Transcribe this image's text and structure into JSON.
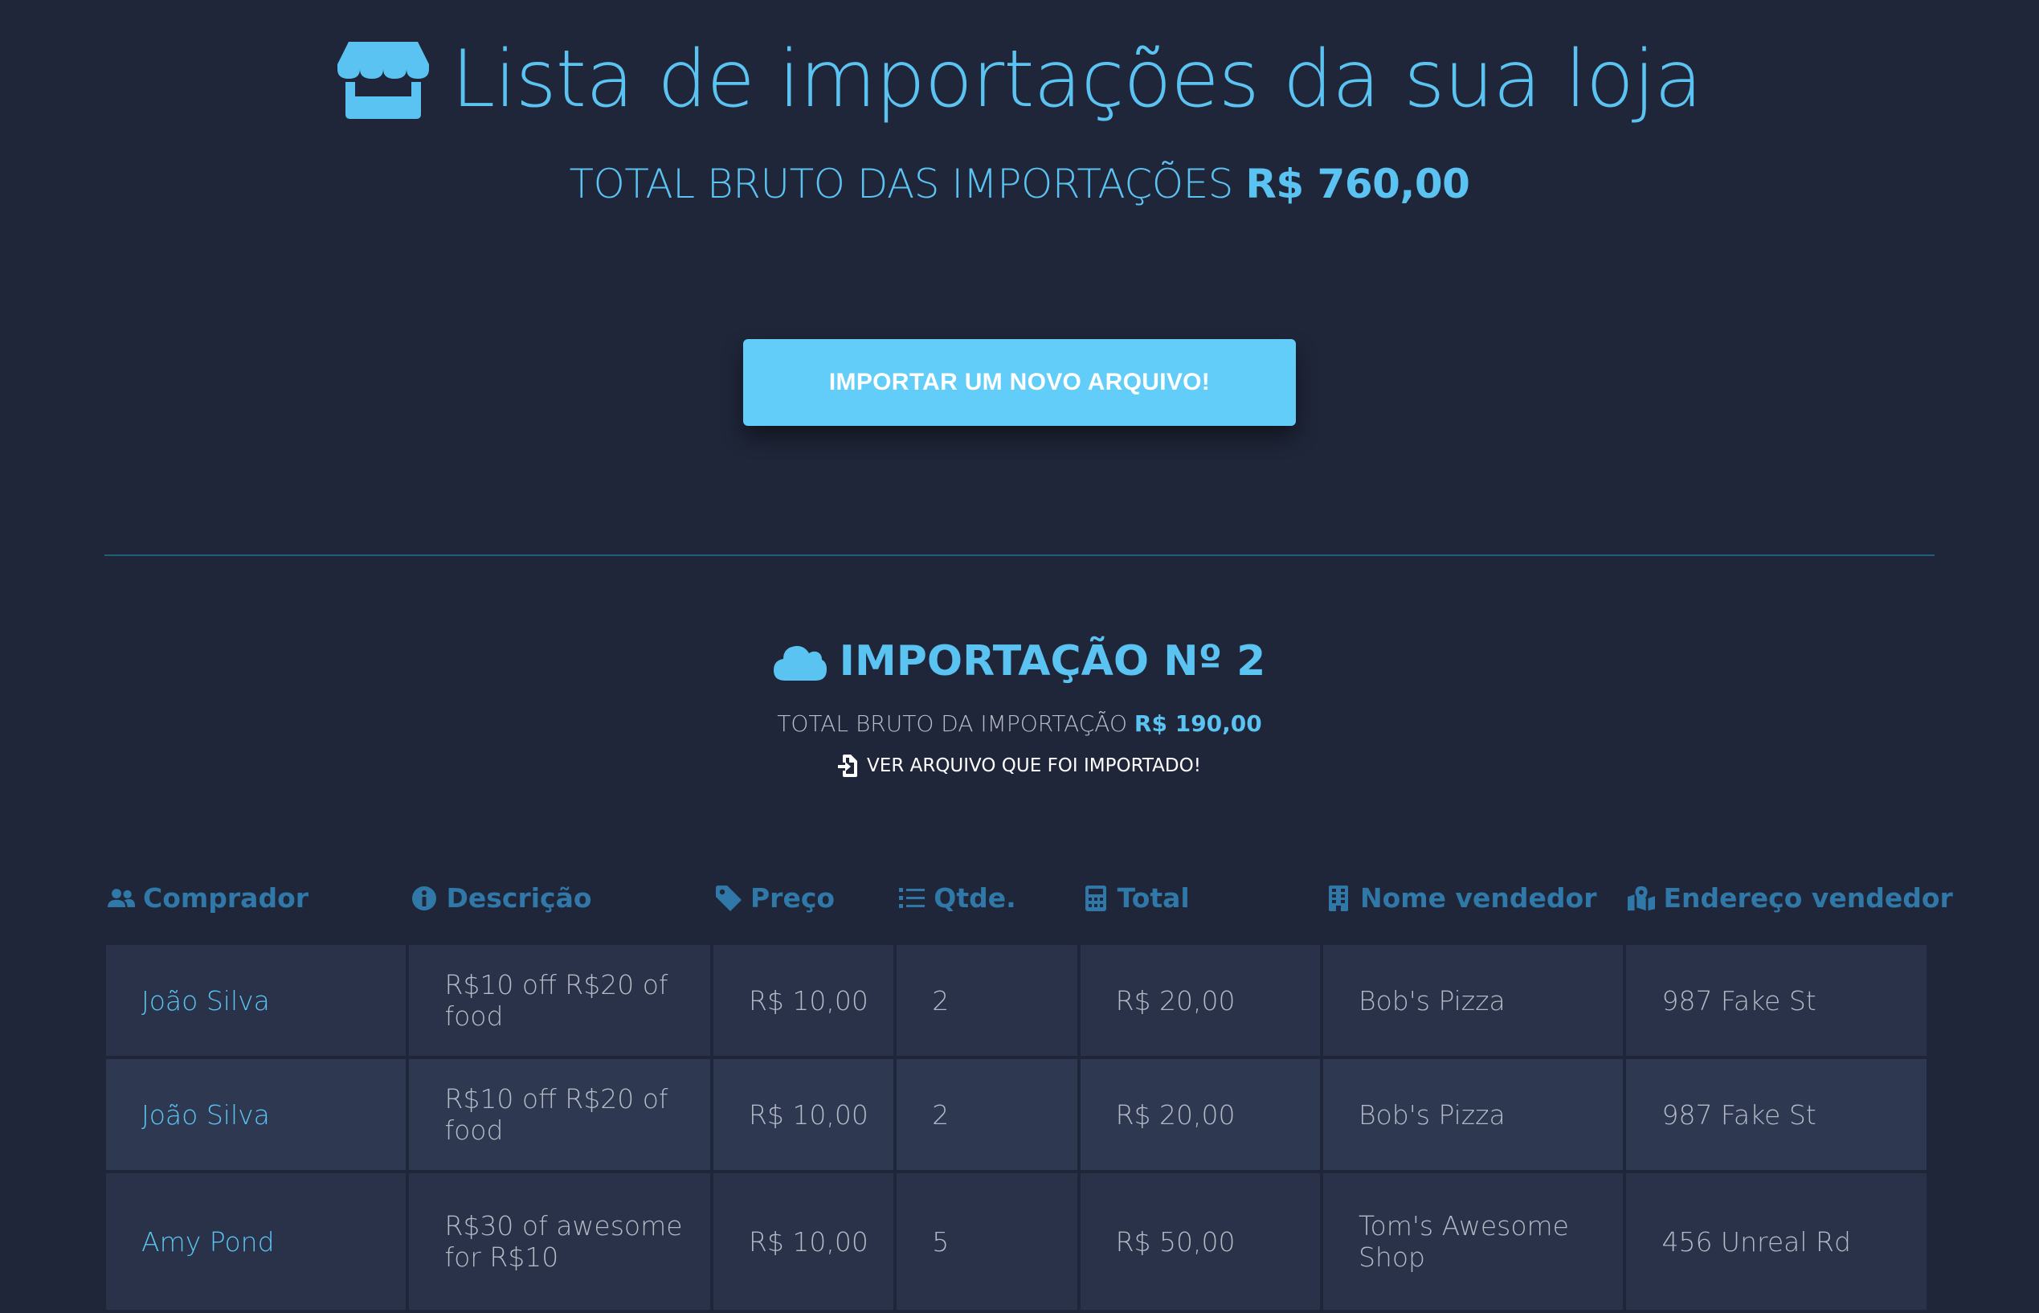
{
  "header": {
    "title": "Lista de importações da sua loja",
    "total_label": "TOTAL BRUTO DAS IMPORTAÇÕES",
    "total_value": "R$ 760,00",
    "import_button": "IMPORTAR UM NOVO ARQUIVO!"
  },
  "import": {
    "title": "IMPORTAÇÃO Nº 2",
    "total_label": "TOTAL BRUTO DA IMPORTAÇÃO",
    "total_value": "R$ 190,00",
    "view_file_link": "VER ARQUIVO QUE FOI IMPORTADO!"
  },
  "table": {
    "columns": [
      {
        "label": "Comprador",
        "icon": "users-icon"
      },
      {
        "label": "Descrição",
        "icon": "info-circle-icon"
      },
      {
        "label": "Preço",
        "icon": "tag-icon"
      },
      {
        "label": "Qtde.",
        "icon": "list-icon"
      },
      {
        "label": "Total",
        "icon": "calculator-icon"
      },
      {
        "label": "Nome vendedor",
        "icon": "building-icon"
      },
      {
        "label": "Endereço vendedor",
        "icon": "map-marked-icon"
      }
    ],
    "rows": [
      {
        "buyer": "João Silva",
        "description": "R$10 off R$20 of food",
        "price": "R$ 10,00",
        "quantity": "2",
        "total": "R$ 20,00",
        "merchant_name": "Bob's Pizza",
        "merchant_address": "987 Fake St"
      },
      {
        "buyer": "João Silva",
        "description": "R$10 off R$20 of food",
        "price": "R$ 10,00",
        "quantity": "2",
        "total": "R$ 20,00",
        "merchant_name": "Bob's Pizza",
        "merchant_address": "987 Fake St"
      },
      {
        "buyer": "Amy Pond",
        "description": "R$30 of awesome for R$10",
        "price": "R$ 10,00",
        "quantity": "5",
        "total": "R$ 50,00",
        "merchant_name": "Tom's Awesome Shop",
        "merchant_address": "456 Unreal Rd"
      }
    ]
  },
  "colors": {
    "background": "#1f2639",
    "accent": "#5bc3f2",
    "button": "#62cdf8",
    "header_text": "#2f78a8",
    "row_dark": "#293248",
    "row_light": "#2e3951"
  }
}
